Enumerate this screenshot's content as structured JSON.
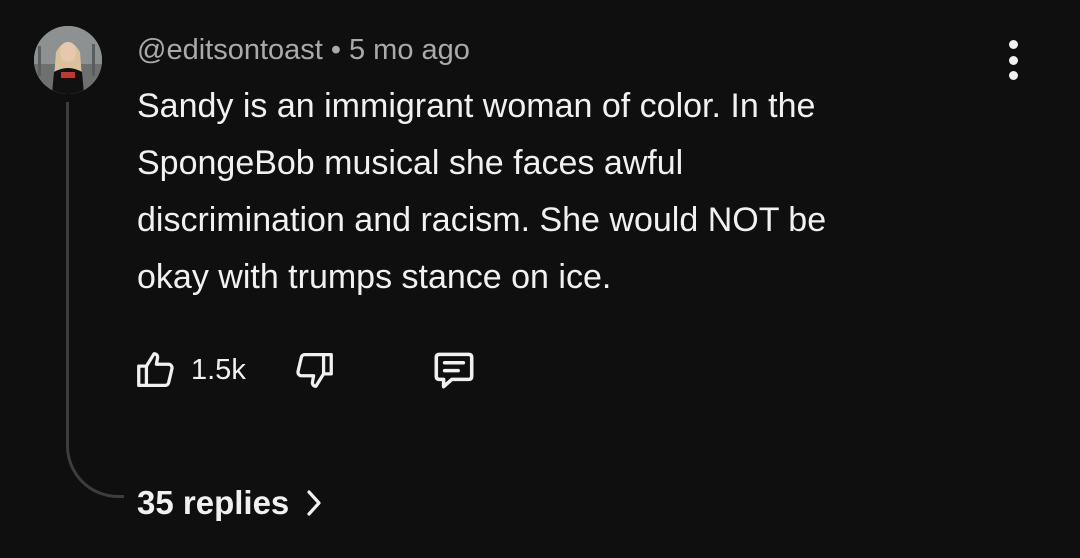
{
  "comment": {
    "handle": "@editsontoast",
    "separator": "•",
    "time": "5 mo ago",
    "text_lines": [
      "Sandy is an immigrant woman of color. In the",
      "SpongeBob musical she faces awful",
      "discrimination and racism. She would NOT be",
      "okay with trumps stance on ice."
    ],
    "like_count": "1.5k",
    "replies_label": "35 replies"
  },
  "icons": {
    "like": "thumbs-up-icon",
    "dislike": "thumbs-down-icon",
    "reply": "comment-icon",
    "menu": "more-vert-icon",
    "replies_arrow": "chevron-right-icon"
  },
  "colors": {
    "background": "#0f0f0f",
    "text": "#f1f1f1",
    "meta": "#aaaaaa",
    "thread_line": "#3d3d3d"
  }
}
